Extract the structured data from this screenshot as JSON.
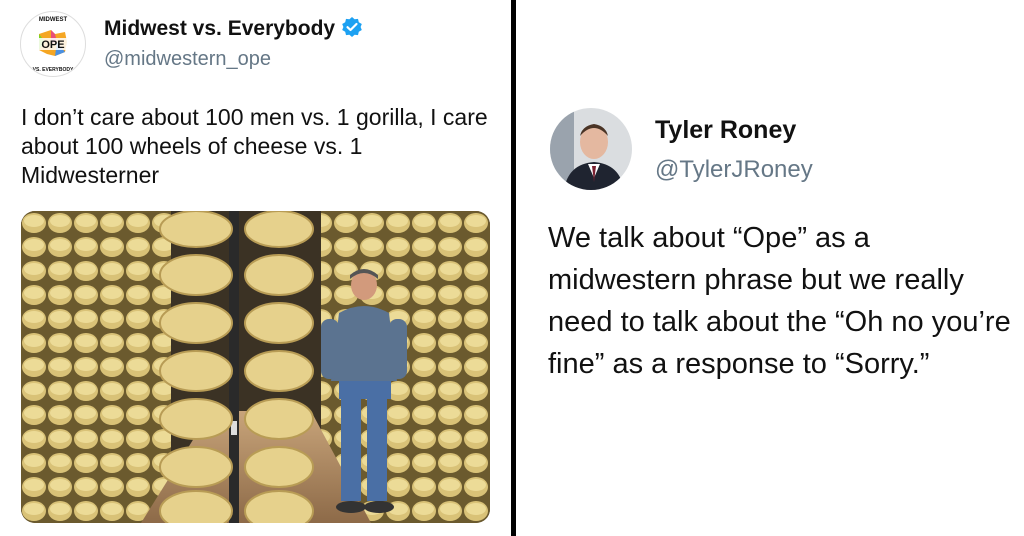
{
  "left_tweet": {
    "display_name": "Midwest vs. Everybody",
    "handle": "@midwestern_ope",
    "avatar": {
      "icon": "ope-logo-icon",
      "logo_text": "OPE",
      "ring_top": "MIDWEST",
      "ring_bottom": "VS. EVERYBODY"
    },
    "verified_icon": "verified-badge-icon",
    "verified_color": "#1DA1F2",
    "text": "I don’t care about 100 men vs. 1 gorilla, I care about 100 wheels of cheese vs. 1 Midwesterner",
    "photo": {
      "subject": "man-in-cheese-warehouse-photo"
    }
  },
  "right_tweet": {
    "display_name": "Tyler Roney",
    "handle": "@TylerJRoney",
    "avatar": {
      "icon": "profile-photo-icon"
    },
    "text": "We talk about “Ope” as a midwestern phrase but we really need to talk about the “Oh no you’re fine” as a response to “Sorry.”"
  }
}
